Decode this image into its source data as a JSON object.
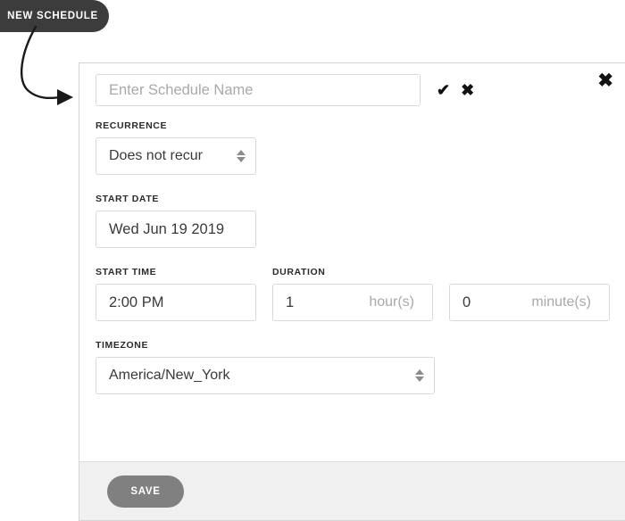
{
  "callout": {
    "pill_label": "NEW SCHEDULE",
    "arrow_icon": "curved-arrow-icon"
  },
  "dialog": {
    "name_field": {
      "placeholder": "Enter Schedule Name",
      "value": "",
      "confirm_icon": "check-icon",
      "cancel_icon": "x-icon"
    },
    "close_icon": "close-icon",
    "fields": {
      "recurrence": {
        "label": "RECURRENCE",
        "value": "Does not recur",
        "spinner_icon": "updown-arrows-icon"
      },
      "start_date": {
        "label": "START DATE",
        "value": "Wed Jun 19 2019"
      },
      "start_time": {
        "label": "START TIME",
        "value": "2:00 PM"
      },
      "duration": {
        "label": "DURATION",
        "hours_value": "1",
        "hours_unit": "hour(s)",
        "minutes_value": "0",
        "minutes_unit": "minute(s)"
      },
      "timezone": {
        "label": "TIMEZONE",
        "value": "America/New_York",
        "spinner_icon": "updown-arrows-icon"
      }
    },
    "footer": {
      "save_label": "SAVE"
    }
  },
  "colors": {
    "pill_background": "#3c3c3c",
    "panel_border": "#d5d5d5",
    "field_border": "#d9d9d9",
    "footer_background": "#f0f0f0",
    "save_button": "#808080",
    "placeholder_text": "#a9a9a9",
    "label_text": "#2b2b2b"
  }
}
